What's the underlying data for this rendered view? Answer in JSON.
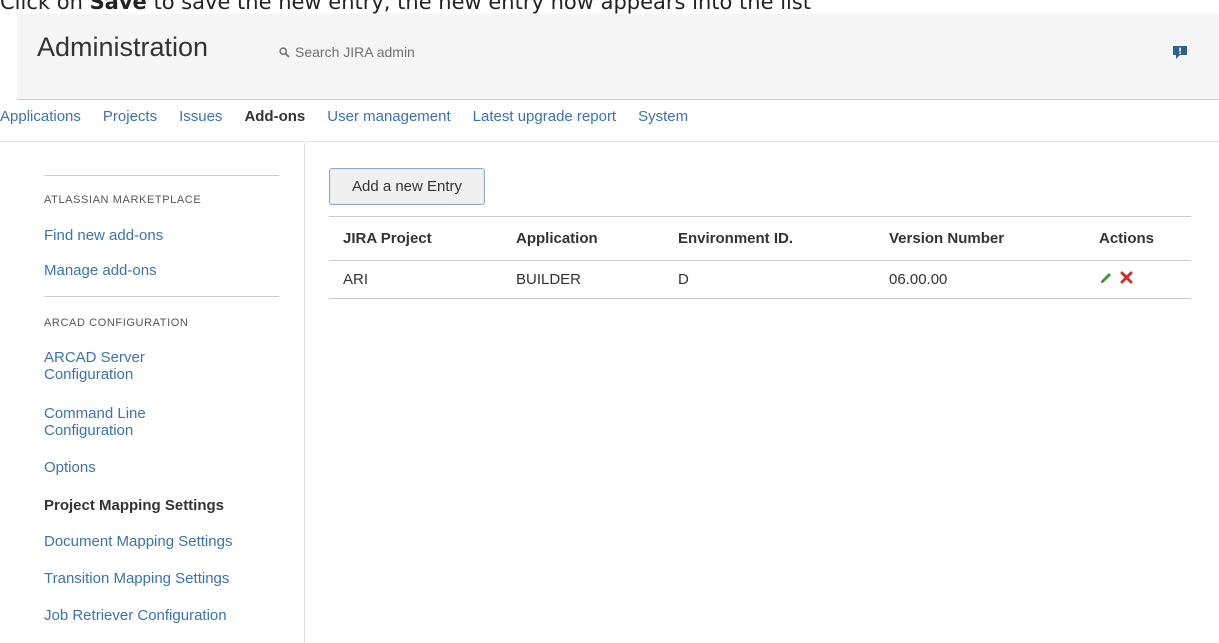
{
  "caption": {
    "before": "Click on ",
    "bold": "Save",
    "after": " to save the new entry, the new entry now appears into the list"
  },
  "header": {
    "title": "Administration",
    "search_placeholder": "Search JIRA admin",
    "icons": [
      "search-icon",
      "feedback-icon"
    ]
  },
  "tabs": [
    {
      "label": "Applications",
      "active": false
    },
    {
      "label": "Projects",
      "active": false
    },
    {
      "label": "Issues",
      "active": false
    },
    {
      "label": "Add-ons",
      "active": true
    },
    {
      "label": "User management",
      "active": false
    },
    {
      "label": "Latest upgrade report",
      "active": false
    },
    {
      "label": "System",
      "active": false
    }
  ],
  "sidebar": {
    "section1": {
      "heading": "ATLASSIAN MARKETPLACE",
      "items": [
        "Find new add-ons",
        "Manage add-ons"
      ]
    },
    "section2": {
      "heading": "ARCAD CONFIGURATION",
      "items": [
        "ARCAD Server Configuration",
        "Command Line Configuration",
        "Options",
        "Project Mapping Settings",
        "Document Mapping Settings",
        "Transition Mapping Settings",
        "Job Retriever Configuration"
      ],
      "active_item": "Project Mapping Settings"
    }
  },
  "main": {
    "add_button": "Add a new Entry",
    "columns": [
      "JIRA Project",
      "Application",
      "Environment ID.",
      "Version Number",
      "Actions"
    ],
    "rows": [
      {
        "project": "ARI",
        "application": "BUILDER",
        "environment": "D",
        "version": "06.00.00"
      }
    ],
    "action_icons": [
      "edit-pencil-icon",
      "delete-x-icon"
    ]
  },
  "colors": {
    "link": "#3b73af",
    "text": "#333333",
    "header_bg": "#f5f5f5",
    "edit_green": "#3c9a2e",
    "delete_red": "#d62a2a"
  }
}
